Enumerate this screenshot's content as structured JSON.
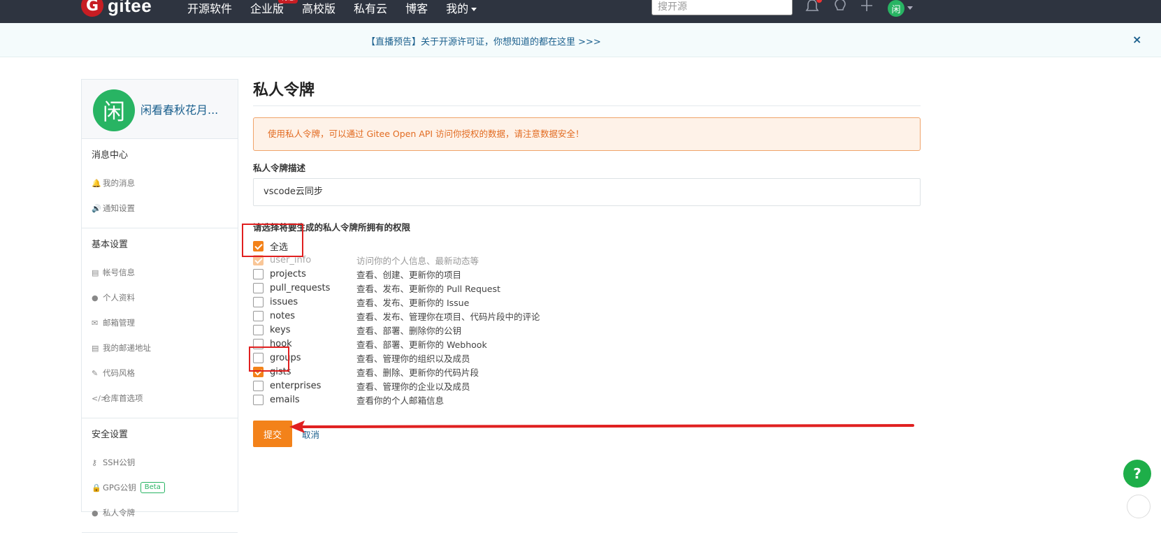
{
  "navbar": {
    "logo_mark": "G",
    "logo_text": "gitee",
    "items": [
      "开源软件",
      "企业版",
      "高校版",
      "私有云",
      "博客",
      "我的"
    ],
    "enterprise_badge": "特惠",
    "search_placeholder": "搜开源",
    "avatar_char": "闲",
    "icons": [
      "bell-icon",
      "lightbulb-icon",
      "plus-icon"
    ]
  },
  "announcement": {
    "text": "【直播预告】关于开源许可证，你想知道的都在这里 >>>",
    "close": "×"
  },
  "sidebar": {
    "avatar_char": "闲",
    "user_name": "闲看春秋花月...",
    "sections": [
      {
        "title": "消息中心",
        "items": [
          {
            "icon": "bell-icon",
            "glyph": "🔔",
            "label": "我的消息"
          },
          {
            "icon": "speaker-icon",
            "glyph": "🔊",
            "label": "通知设置"
          }
        ]
      },
      {
        "title": "基本设置",
        "items": [
          {
            "icon": "id-card-icon",
            "glyph": "▤",
            "label": "帐号信息"
          },
          {
            "icon": "user-icon",
            "glyph": "●",
            "label": "个人资料"
          },
          {
            "icon": "mail-icon",
            "glyph": "✉",
            "label": "邮箱管理"
          },
          {
            "icon": "id-card-icon",
            "glyph": "▤",
            "label": "我的邮递地址"
          },
          {
            "icon": "brush-icon",
            "glyph": "✎",
            "label": "代码风格"
          },
          {
            "icon": "code-icon",
            "glyph": "</>",
            "label": "仓库首选项"
          }
        ]
      },
      {
        "title": "安全设置",
        "items": [
          {
            "icon": "key-icon",
            "glyph": "⚷",
            "label": "SSH公钥"
          },
          {
            "icon": "lock-icon",
            "glyph": "🔒",
            "label": "GPG公钥",
            "badge": "Beta"
          },
          {
            "icon": "user-icon",
            "glyph": "●",
            "label": "私人令牌"
          }
        ]
      }
    ]
  },
  "main": {
    "title": "私人令牌",
    "alert": "使用私人令牌，可以通过 Gitee Open API 访问你授权的数据，请注意数据安全！",
    "desc_label": "私人令牌描述",
    "desc_value": "vscode云同步",
    "perm_label": "请选择将要生成的私人令牌所拥有的权限",
    "select_all": {
      "label": "全选",
      "checked": true
    },
    "permissions": [
      {
        "name": "user_info",
        "desc": "访问你的个人信息、最新动态等",
        "checked": true,
        "disabled": true
      },
      {
        "name": "projects",
        "desc": "查看、创建、更新你的项目",
        "checked": false
      },
      {
        "name": "pull_requests",
        "desc": "查看、发布、更新你的 Pull Request",
        "checked": false
      },
      {
        "name": "issues",
        "desc": "查看、发布、更新你的 Issue",
        "checked": false
      },
      {
        "name": "notes",
        "desc": "查看、发布、管理你在项目、代码片段中的评论",
        "checked": false
      },
      {
        "name": "keys",
        "desc": "查看、部署、删除你的公钥",
        "checked": false
      },
      {
        "name": "hook",
        "desc": "查看、部署、更新你的 Webhook",
        "checked": false
      },
      {
        "name": "groups",
        "desc": "查看、管理你的组织以及成员",
        "checked": false
      },
      {
        "name": "gists",
        "desc": "查看、删除、更新你的代码片段",
        "checked": true
      },
      {
        "name": "enterprises",
        "desc": "查看、管理你的企业以及成员",
        "checked": false
      },
      {
        "name": "emails",
        "desc": "查看你的个人邮箱信息",
        "checked": false
      }
    ],
    "submit_label": "提交",
    "cancel_label": "取消"
  },
  "help_button": "?",
  "colors": {
    "accent": "#f3821a",
    "annotation": "#e02020",
    "brand_green": "#28b463"
  }
}
